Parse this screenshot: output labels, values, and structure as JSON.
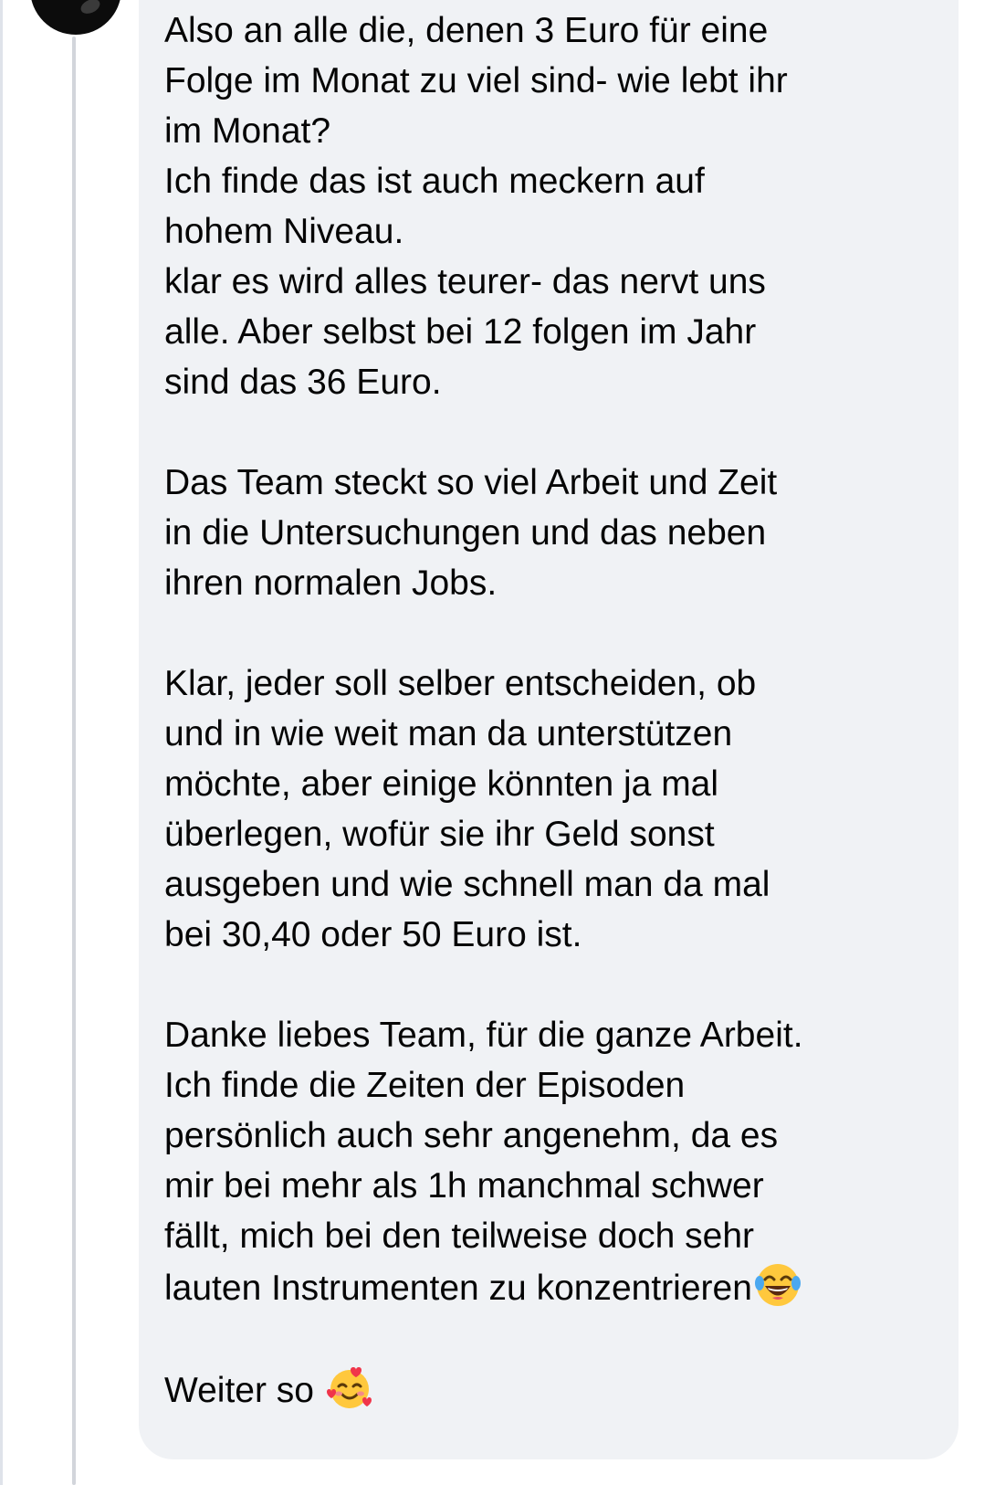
{
  "comment": {
    "paragraphs": [
      [
        "Also an alle die, denen 3 Euro für eine",
        "Folge im Monat zu viel sind- wie lebt ihr",
        "im Monat?",
        "Ich finde das ist auch meckern auf",
        "hohem Niveau.",
        "klar es wird alles teurer- das nervt uns",
        "alle. Aber selbst bei 12 folgen im Jahr",
        "sind das 36 Euro."
      ],
      [
        "Das Team steckt so viel Arbeit und Zeit",
        "in die Untersuchungen und das neben",
        "ihren normalen Jobs."
      ],
      [
        "Klar, jeder soll selber entscheiden, ob",
        "und in wie weit man da unterstützen",
        "möchte, aber einige könnten ja mal",
        "überlegen, wofür sie ihr Geld sonst",
        "ausgeben und wie schnell man da mal",
        "bei 30,40 oder 50 Euro ist."
      ],
      [
        "Danke liebes Team, für die ganze Arbeit.",
        "Ich finde die Zeiten der Episoden",
        "persönlich auch sehr angenehm, da es",
        "mir bei mehr als 1h manchmal schwer",
        "fällt, mich bei den teilweise doch sehr",
        "lauten Instrumenten zu konzentrieren"
      ],
      [
        "Weiter so "
      ]
    ],
    "emojis": {
      "laughing": "tears-of-joy-emoji",
      "hearts": "smiling-face-with-hearts-emoji"
    }
  },
  "colors": {
    "bubble_background": "#f0f2f5",
    "text": "#050505",
    "thread_line": "#d2d5db",
    "emoji_yellow": "#ffc83d",
    "heart_red": "#f0354a"
  }
}
